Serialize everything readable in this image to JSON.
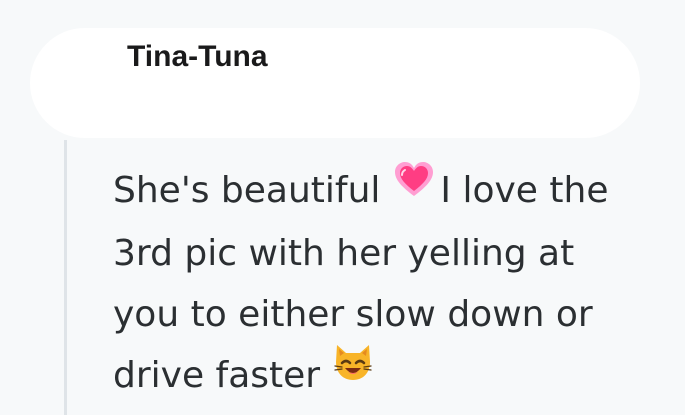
{
  "comment": {
    "author": "Tina-Tuna",
    "lines": [
      "She's beautiful",
      "I love the",
      "3rd pic with her yelling at",
      "you to either slow down or",
      "drive faster"
    ],
    "icons": {
      "after_line_1": "sparkling-heart-icon",
      "after_line_5": "smiling-cat-face-icon"
    }
  },
  "colors": {
    "background": "#f7f9fa",
    "text": "#2b2f32",
    "author": "#1a1a1b",
    "heart": "#ff3d83",
    "cat": "#f8b428"
  }
}
